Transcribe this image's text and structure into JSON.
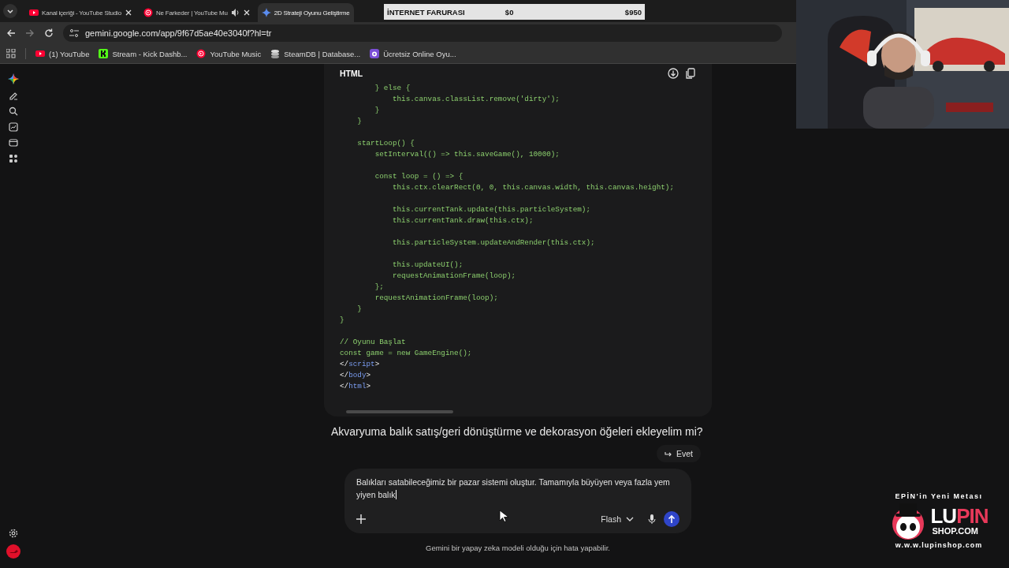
{
  "browser": {
    "tabs": [
      {
        "title": "Kanal içeriği - YouTube Studio",
        "kind": "studio",
        "audio": false,
        "closable": true,
        "selected": false
      },
      {
        "title": "Ne Farkeder | YouTube Mu",
        "kind": "music",
        "audio": true,
        "closable": true,
        "selected": false
      },
      {
        "title": "2D Strateji Oyunu Geliştirme",
        "kind": "gemini",
        "audio": false,
        "closable": false,
        "selected": true
      }
    ],
    "address": "gemini.google.com/app/9f67d5ae40e3040f?hl=tr",
    "bookmarks": [
      {
        "label": "(1) YouTube",
        "kind": "youtube"
      },
      {
        "label": "Stream - Kick Dashb...",
        "kind": "kick"
      },
      {
        "label": "YouTube Music",
        "kind": "music"
      },
      {
        "label": "SteamDB | Database...",
        "kind": "stack"
      },
      {
        "label": "Ücretsiz Online Oyu...",
        "kind": "game"
      }
    ]
  },
  "code_block": {
    "language": "HTML",
    "blocks": [
      [
        "        } else {",
        "            this.canvas.classList.remove('dirty');",
        "        }",
        "    }"
      ],
      [
        "    startLoop() {",
        "        setInterval(() => this.saveGame(), 10000);"
      ],
      [
        "        const loop = () => {",
        "            this.ctx.clearRect(0, 0, this.canvas.width, this.canvas.height);"
      ],
      [
        "            this.currentTank.update(this.particleSystem);",
        "            this.currentTank.draw(this.ctx);"
      ],
      [
        "            this.particleSystem.updateAndRender(this.ctx);"
      ],
      [
        "            this.updateUI();",
        "            requestAnimationFrame(loop);",
        "        };",
        "        requestAnimationFrame(loop);",
        "    }",
        "}"
      ],
      [
        "// Oyunu Başlat",
        "const game = new GameEngine();",
        [
          {
            "text": "</",
            "kind": "punct"
          },
          {
            "text": "script",
            "kind": "tag"
          },
          {
            "text": ">",
            "kind": "punct"
          }
        ],
        [
          {
            "text": "</",
            "kind": "punct"
          },
          {
            "text": "body",
            "kind": "tag"
          },
          {
            "text": ">",
            "kind": "punct"
          }
        ],
        [
          {
            "text": "</",
            "kind": "punct"
          },
          {
            "text": "html",
            "kind": "tag"
          },
          {
            "text": ">",
            "kind": "punct"
          }
        ]
      ]
    ]
  },
  "question": "Akvaryuma balık satış/geri dönüştürme ve dekorasyon öğeleri ekleyelim mi?",
  "suggestion": "Evet",
  "prompt": {
    "value": "Balıkları satabileceğimiz bir pazar sistemi oluştur. Tamamıyla büyüyen veya fazla yem yiyen balık",
    "model": "Flash"
  },
  "disclaimer": "Gemini bir yapay zeka modeli olduğu için hata yapabilir.",
  "stream_overlay": {
    "label": "İNTERNET FARURASI",
    "current": "$0",
    "goal": "$950"
  },
  "promo": {
    "tagline": "EPİN'in Yeni Metası",
    "brand": [
      {
        "text": "LU",
        "color": "#ffffff"
      },
      {
        "text": "PIN",
        "color": "#e8395a"
      }
    ],
    "domain": "SHOP.COM",
    "url": "w.w.w.lupinshop.com"
  }
}
